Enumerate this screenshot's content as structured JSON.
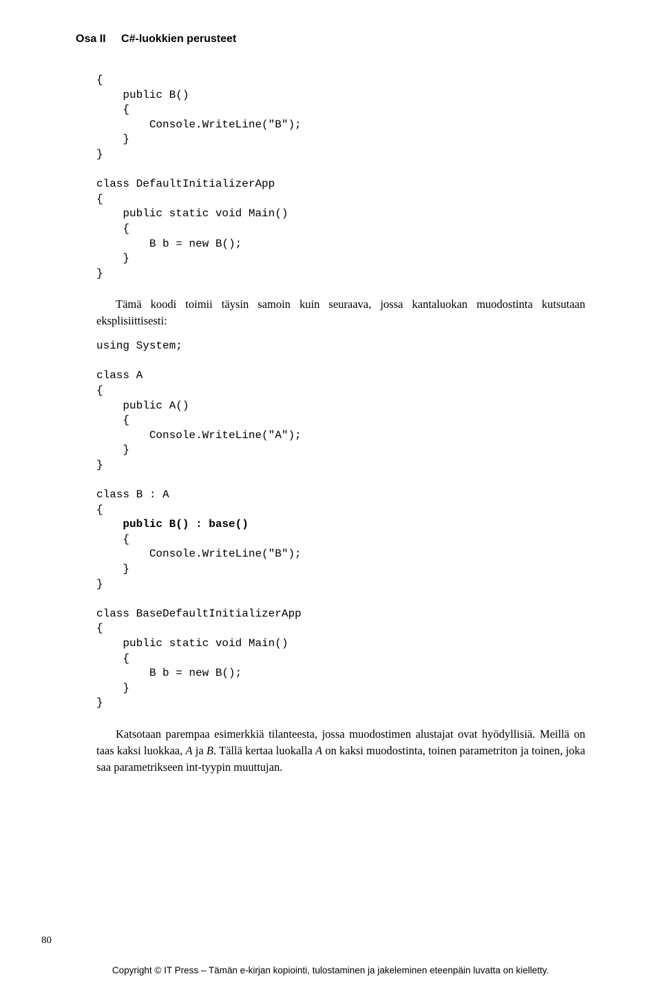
{
  "header": {
    "part": "Osa II",
    "title": "C#-luokkien perusteet"
  },
  "code_block_1": "{\n    public B()\n    {\n        Console.WriteLine(\"B\");\n    }\n}\n\nclass DefaultInitializerApp\n{\n    public static void Main()\n    {\n        B b = new B();\n    }\n}",
  "paragraph_1": "Tämä koodi toimii täysin samoin kuin seuraava, jossa kantaluokan muodostinta kutsutaan eksplisiittisesti:",
  "code_block_2_pre": "using System;\n\nclass A\n{\n    public A()\n    {\n        Console.WriteLine(\"A\");\n    }\n}\n\nclass B : A\n{\n    ",
  "code_block_2_bold": "public B() : base()",
  "code_block_2_post": "\n    {\n        Console.WriteLine(\"B\");\n    }\n}\n\nclass BaseDefaultInitializerApp\n{\n    public static void Main()\n    {\n        B b = new B();\n    }\n}",
  "paragraph_2_a": "Katsotaan parempaa esimerkkiä tilanteesta, jossa muodostimen alustajat ovat hyödyllisiä. Meillä on taas kaksi luokkaa, ",
  "paragraph_2_it1": "A",
  "paragraph_2_b": " ja ",
  "paragraph_2_it2": "B",
  "paragraph_2_c": ". Tällä kertaa luokalla ",
  "paragraph_2_it3": "A",
  "paragraph_2_d": " on kaksi muodostinta, toinen parametriton ja toinen, joka saa parametrikseen int-tyypin muuttujan.",
  "page_number": "80",
  "footer": "Copyright © IT Press – Tämän e-kirjan kopiointi, tulostaminen ja jakeleminen eteenpäin luvatta on kielletty."
}
